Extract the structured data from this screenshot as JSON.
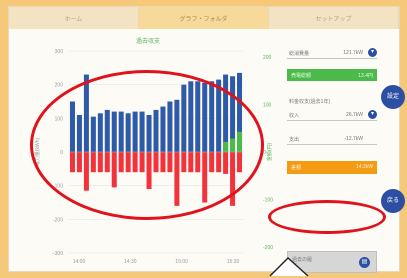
{
  "tabs": [
    "ホーム",
    "グラフ・フォルダ",
    "セットアップ"
  ],
  "tabs_active": 1,
  "chart_data": {
    "type": "bar",
    "title": "過去収支",
    "ylabel_left": "電力量(kWh)",
    "ylabel_right": "金額(円)",
    "yticks_left": [
      "300",
      "200",
      "100",
      "0",
      "-100",
      "-200",
      "-300"
    ],
    "yticks_right": [
      "200",
      "100",
      "0",
      "-100",
      "-200"
    ],
    "xticks": [
      "14:00",
      "14:30",
      "15:00",
      "15:30"
    ],
    "ylim": [
      -300,
      300
    ],
    "series": [
      {
        "name": "",
        "color": "#2f5aa8",
        "values": [
          150,
          110,
          230,
          105,
          115,
          125,
          120,
          120,
          115,
          120,
          120,
          110,
          125,
          135,
          150,
          155,
          200,
          210,
          210,
          205,
          210,
          215,
          230,
          225,
          235
        ]
      },
      {
        "name": "",
        "color": "#f2333b",
        "values": [
          -60,
          -60,
          -115,
          -60,
          -60,
          -60,
          -105,
          -60,
          -60,
          -60,
          -60,
          -110,
          -60,
          -60,
          -60,
          -160,
          -60,
          -60,
          -60,
          -150,
          -60,
          -60,
          -65,
          -160,
          -60
        ]
      },
      {
        "name": "",
        "color": "#4cba4a",
        "values": [
          0,
          0,
          0,
          0,
          0,
          0,
          0,
          0,
          0,
          0,
          0,
          0,
          0,
          0,
          0,
          0,
          0,
          0,
          0,
          0,
          0,
          0,
          30,
          40,
          60
        ]
      }
    ]
  },
  "panel": {
    "row1_label": "総消費量",
    "row1_value": "121.7kW",
    "green_label": "売電総額",
    "green_value": "13.4円",
    "section_label": "料金収支(過去1年)",
    "row2_label": "収入",
    "row2_value": "26.7kW",
    "row3_label": "支出",
    "row3_value": "-12.7kW",
    "orange_label": "差額",
    "orange_value": "14.2kW",
    "side_btn1": "設定",
    "side_btn2": "戻る",
    "mini_label": "過去の履歴",
    "mini_icon": "▤"
  }
}
